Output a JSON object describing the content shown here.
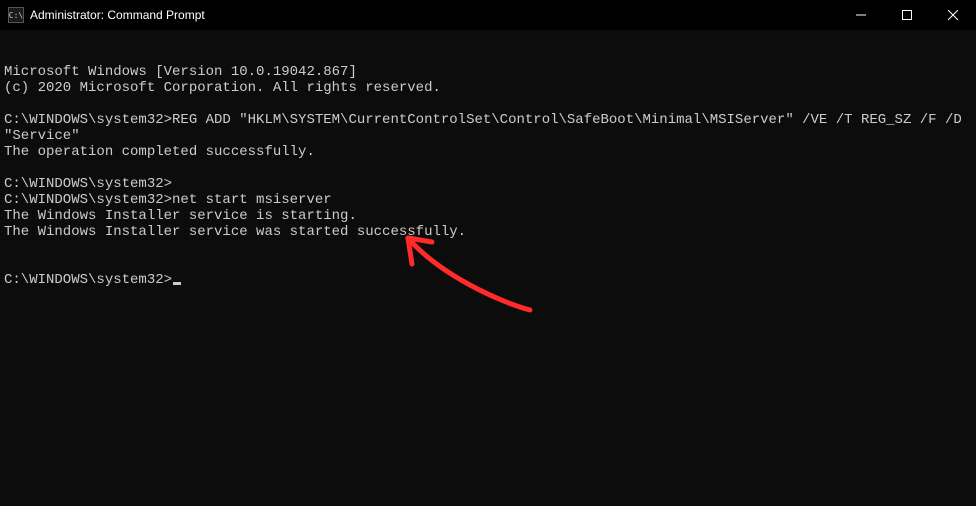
{
  "window": {
    "title": "Administrator: Command Prompt",
    "icon_label": "C:\\"
  },
  "terminal": {
    "lines": [
      "Microsoft Windows [Version 10.0.19042.867]",
      "(c) 2020 Microsoft Corporation. All rights reserved.",
      "",
      "C:\\WINDOWS\\system32>REG ADD \"HKLM\\SYSTEM\\CurrentControlSet\\Control\\SafeBoot\\Minimal\\MSIServer\" /VE /T REG_SZ /F /D \"Service\"",
      "The operation completed successfully.",
      "",
      "C:\\WINDOWS\\system32>",
      "C:\\WINDOWS\\system32>net start msiserver",
      "The Windows Installer service is starting.",
      "The Windows Installer service was started successfully.",
      "",
      "",
      "C:\\WINDOWS\\system32>"
    ],
    "prompt_cursor_line_index": 12
  },
  "annotation": {
    "arrow_color": "#ff2a2a"
  }
}
